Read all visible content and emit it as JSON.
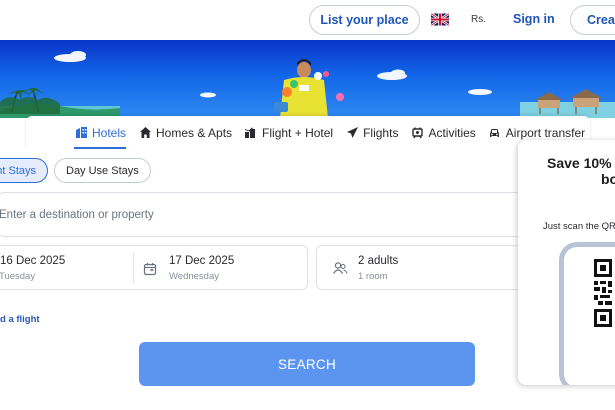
{
  "header": {
    "list_place_label": "List your place",
    "currency": "Rs.",
    "sign_in_label": "Sign in",
    "create_label": "Create"
  },
  "tabs": [
    {
      "label": "Hotels",
      "icon": "hotel-icon",
      "active": true
    },
    {
      "label": "Homes & Apts",
      "icon": "home-icon",
      "active": false
    },
    {
      "label": "Flight + Hotel",
      "icon": "flight-hotel-icon",
      "active": false
    },
    {
      "label": "Flights",
      "icon": "plane-icon",
      "active": false
    },
    {
      "label": "Activities",
      "icon": "activities-icon",
      "active": false
    },
    {
      "label": "Airport transfer",
      "icon": "car-icon",
      "active": false
    }
  ],
  "stay_type": {
    "overnight_label": "Overnight Stays",
    "overnight_visible": "ght Stays",
    "day_use_label": "Day Use Stays"
  },
  "destination": {
    "placeholder": "Enter a destination or property"
  },
  "dates": {
    "check_in": "16 Dec 2025",
    "check_in_day": "Tuesday",
    "check_out": "17 Dec 2025",
    "check_out_day": "Wednesday"
  },
  "guests": {
    "adults": "2 adults",
    "rooms": "1 room"
  },
  "add_flight_visible": "d a flight",
  "search_label": "SEARCH",
  "promo": {
    "title_line1": "Save 10% o",
    "title_line2": "bo",
    "subtitle": "Just scan the QR"
  },
  "colors": {
    "accent": "#2d6ed8",
    "link": "#1f54b8",
    "search_button": "#5b95f0",
    "banner_blue": "#1266e8"
  }
}
